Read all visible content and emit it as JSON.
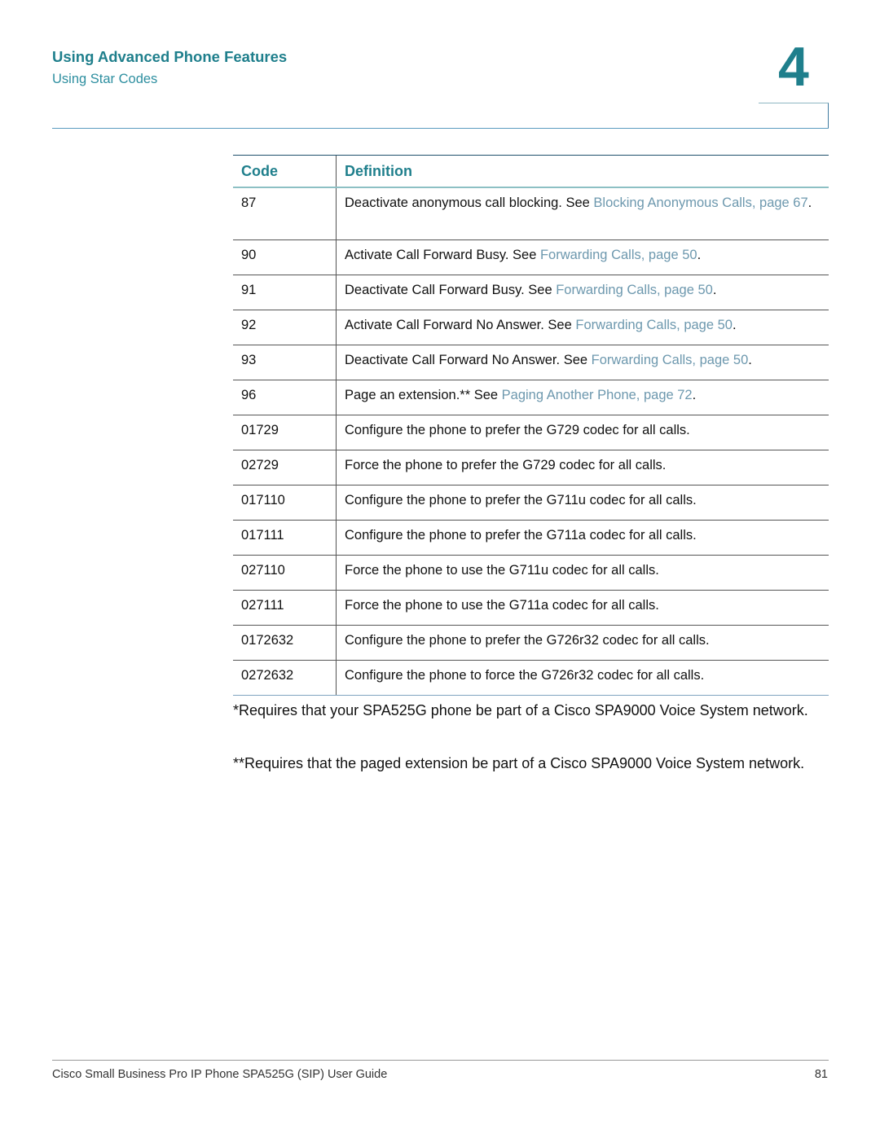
{
  "header": {
    "chapter_title": "Using Advanced Phone Features",
    "section_title": "Using Star Codes",
    "chapter_number": "4"
  },
  "table": {
    "headers": {
      "code": "Code",
      "definition": "Definition"
    },
    "rows": [
      {
        "code": "87",
        "text": "Deactivate anonymous call blocking. See ",
        "link": "Blocking Anonymous Calls, page 67",
        "suffix": "."
      },
      {
        "code": "90",
        "text": "Activate Call Forward Busy. See ",
        "link": "Forwarding Calls, page 50",
        "suffix": "."
      },
      {
        "code": "91",
        "text": "Deactivate Call Forward Busy. See ",
        "link": "Forwarding Calls, page 50",
        "suffix": "."
      },
      {
        "code": "92",
        "text": "Activate Call Forward No Answer. See ",
        "link": "Forwarding Calls, page 50",
        "suffix": "."
      },
      {
        "code": "93",
        "text": "Deactivate Call Forward No Answer. See ",
        "link": "Forwarding Calls, page 50",
        "suffix": "."
      },
      {
        "code": "96",
        "text": "Page an extension.** See ",
        "link": "Paging Another Phone, page 72",
        "suffix": "."
      },
      {
        "code": "01729",
        "text": "Configure the phone to prefer the G729 codec for all calls.",
        "link": "",
        "suffix": ""
      },
      {
        "code": "02729",
        "text": "Force the phone to prefer the G729 codec for all calls.",
        "link": "",
        "suffix": ""
      },
      {
        "code": "017110",
        "text": "Configure the phone to prefer the G711u codec for all calls.",
        "link": "",
        "suffix": ""
      },
      {
        "code": "017111",
        "text": "Configure the phone to prefer the G711a codec for all calls.",
        "link": "",
        "suffix": ""
      },
      {
        "code": "027110",
        "text": "Force the phone to use the G711u codec for all calls.",
        "link": "",
        "suffix": ""
      },
      {
        "code": "027111",
        "text": "Force the phone to use the G711a codec for all calls.",
        "link": "",
        "suffix": ""
      },
      {
        "code": "0172632",
        "text": "Configure the phone to prefer the G726r32 codec for all calls.",
        "link": "",
        "suffix": ""
      },
      {
        "code": "0272632",
        "text": "Configure the phone to force the G726r32 codec for all calls.",
        "link": "",
        "suffix": ""
      }
    ]
  },
  "notes": [
    "*Requires that your SPA525G phone be part of a Cisco SPA9000 Voice System network.",
    "**Requires that the paged extension be part of a Cisco SPA9000 Voice System network."
  ],
  "footer": {
    "title": "Cisco Small Business Pro IP Phone SPA525G (SIP) User Guide",
    "page_number": "81"
  },
  "colors": {
    "accent": "#1f7f8c",
    "link": "#6d98ae"
  }
}
